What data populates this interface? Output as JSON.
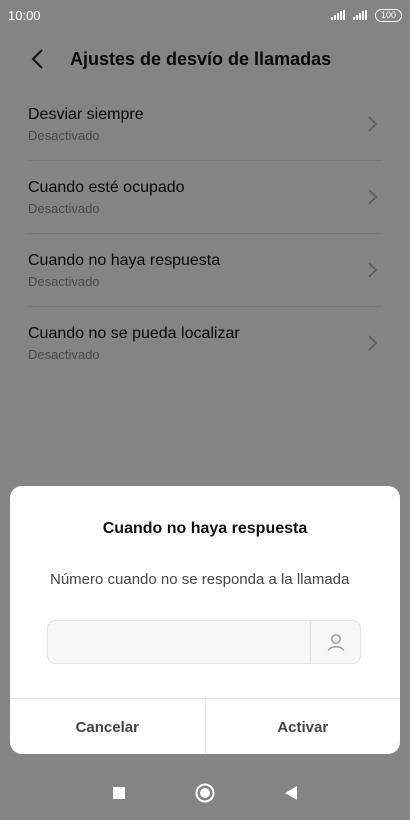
{
  "status_bar": {
    "time": "10:00",
    "battery": "100",
    "icons": [
      "signal-icon",
      "signal-icon",
      "battery-icon"
    ]
  },
  "header": {
    "title": "Ajustes de desvío de llamadas",
    "back_icon": "chevron-left-icon"
  },
  "list": {
    "items": [
      {
        "title": "Desviar siempre",
        "subtitle": "Desactivado"
      },
      {
        "title": "Cuando esté ocupado",
        "subtitle": "Desactivado"
      },
      {
        "title": "Cuando no haya respuesta",
        "subtitle": "Desactivado"
      },
      {
        "title": "Cuando no se pueda localizar",
        "subtitle": "Desactivado"
      }
    ]
  },
  "dialog": {
    "title": "Cuando no haya respuesta",
    "label": "Número cuando no se responda a la llamada",
    "input_value": "",
    "input_placeholder": "",
    "contact_icon": "person-icon",
    "cancel_label": "Cancelar",
    "activate_label": "Activar"
  },
  "nav_bar": {
    "icons": [
      "square-icon",
      "circle-icon",
      "triangle-back-icon"
    ]
  },
  "colors": {
    "overlay": "#000000",
    "dialog_bg": "#ffffff",
    "text_primary": "#111111",
    "text_secondary": "#888888"
  }
}
